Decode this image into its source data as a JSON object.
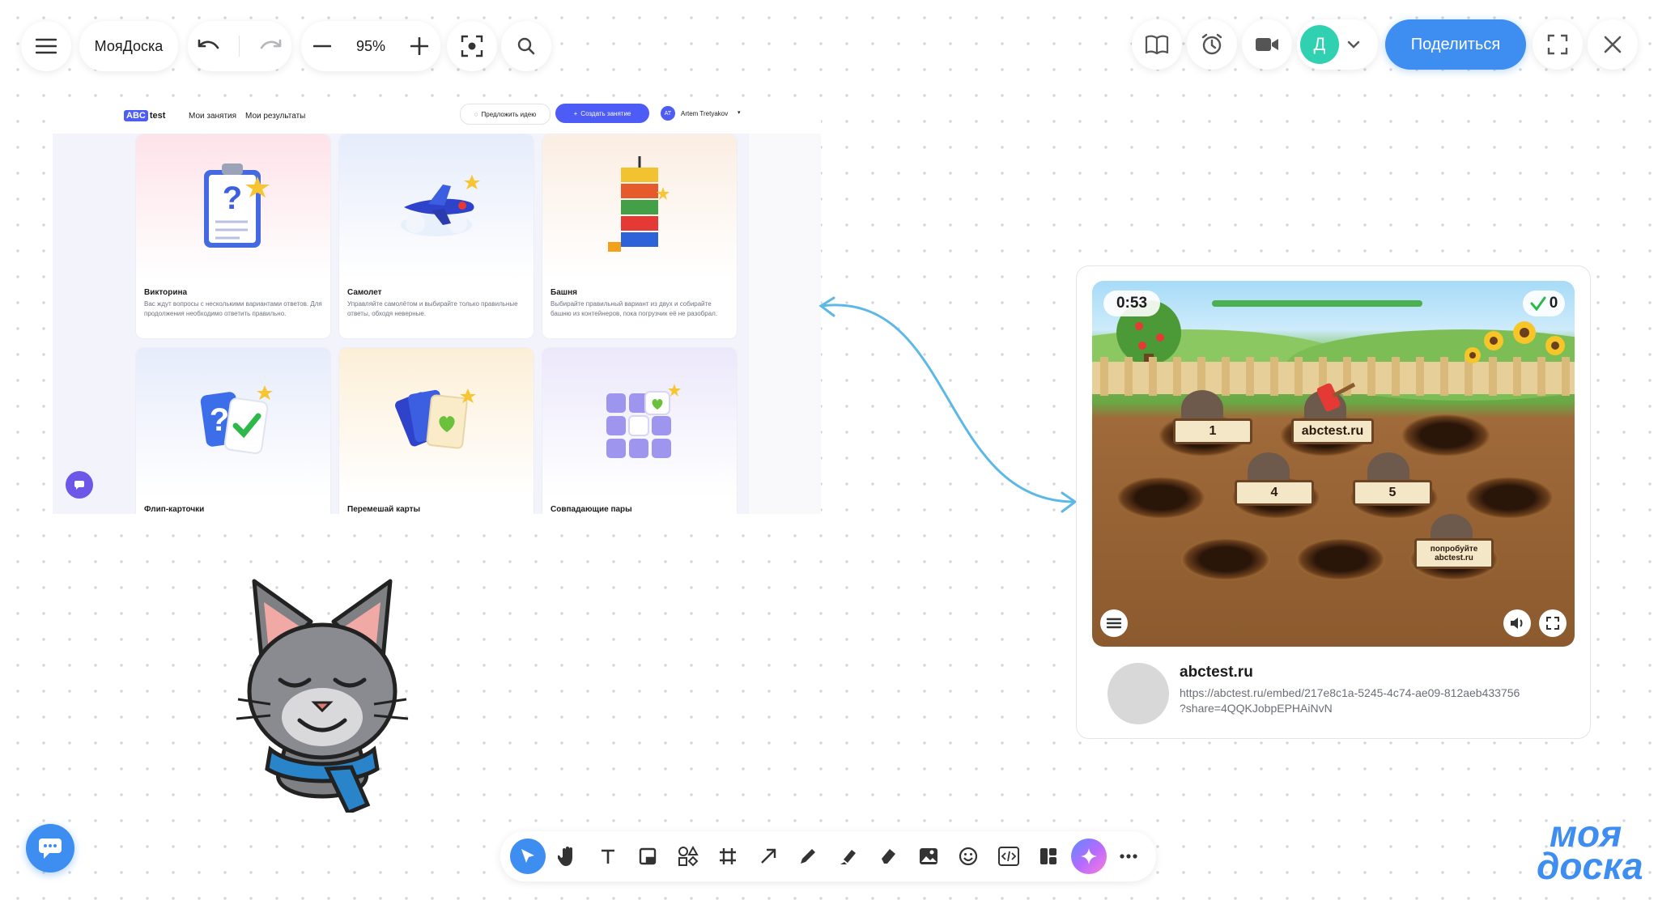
{
  "topbar": {
    "board_name": "МояДоска",
    "zoom": "95%",
    "avatar_letter": "Д",
    "share_label": "Поделиться"
  },
  "embed_site": {
    "logo_abc": "ABC",
    "logo_test": "test",
    "nav": [
      "Мои занятия",
      "Мои результаты"
    ],
    "suggest": "Предложить идею",
    "create": "Создать занятие",
    "user_initials": "AT",
    "user_name": "Artem Tretyakov",
    "cards": [
      {
        "title": "Викторина",
        "desc": "Вас ждут вопросы с несколькими вариантами ответов. Для продолжения необходимо ответить правильно."
      },
      {
        "title": "Самолет",
        "desc": "Управляйте самолётом и выбирайте только правильные ответы, обходя неверные."
      },
      {
        "title": "Башня",
        "desc": "Выбирайте правильный вариант из двух и собирайте башню из контейнеров, пока погрузчик её не разобрал."
      },
      {
        "title": "Флип-карточки",
        "desc": ""
      },
      {
        "title": "Перемешай карты",
        "desc": ""
      },
      {
        "title": "Совпадающие пары",
        "desc": ""
      }
    ]
  },
  "game": {
    "timer": "0:53",
    "score": "0",
    "signs": [
      "1",
      "abctest.ru",
      "4",
      "5",
      "попробуйте abctest.ru"
    ],
    "link_title": "abctest.ru",
    "link_url_1": "https://abctest.ru/embed/217e8c1a-5245-4c74-ae09-812aeb433756",
    "link_url_2": "?share=4QQKJobpEPHAiNvN"
  },
  "brand": {
    "line1": "моя",
    "line2": "доска"
  },
  "colors": {
    "accent": "#3d8ef0",
    "avatar": "#2fd1b0",
    "connector": "#5cb8e6",
    "create_button": "#4d5cf5"
  }
}
